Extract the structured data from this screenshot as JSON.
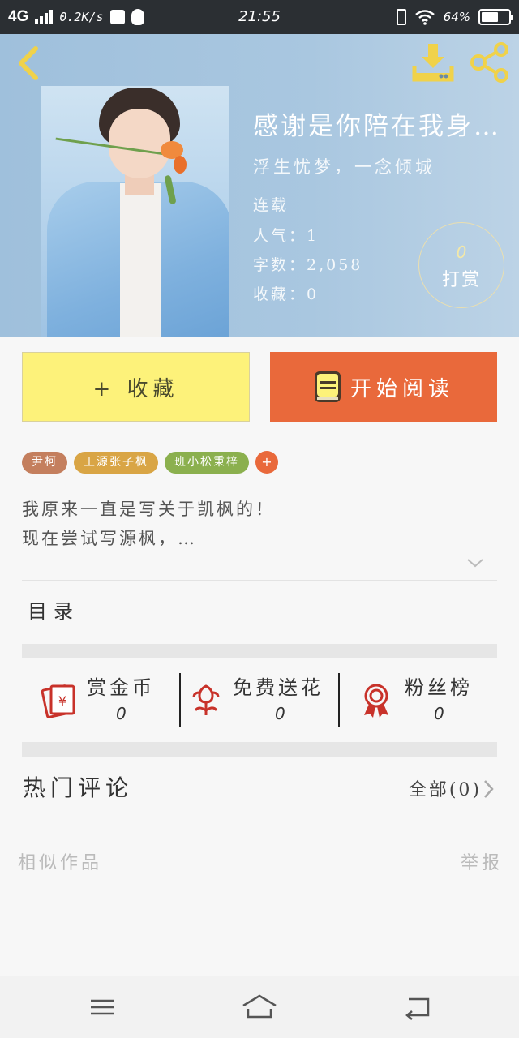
{
  "status_bar": {
    "network": "4G",
    "speed": "0.2K/s",
    "time": "21:55",
    "battery": "64%",
    "battery_level": 0.64
  },
  "header": {
    "icons": [
      "back-icon",
      "download-icon",
      "share-icon"
    ],
    "book": {
      "title": "感谢是你陪在我身…",
      "author_line": "浮生忧梦，一念倾城",
      "status": "连载",
      "popularity": "人气：1",
      "word_count": "字数：2,058",
      "favorites": "收藏：0"
    },
    "tip": {
      "count": "0",
      "label": "打赏"
    }
  },
  "actions": {
    "collect_label": "+ 收藏",
    "read_label": "开始阅读"
  },
  "tags": [
    {
      "label": "尹柯",
      "color": "#c47f5e"
    },
    {
      "label": "王源张子枫",
      "color": "#d9a545"
    },
    {
      "label": "班小松秉梓",
      "color": "#8bb04e"
    }
  ],
  "tag_add": "+",
  "intro": {
    "line1": "我原来一直是写关于凯枫的！",
    "line2": "现在尝试写源枫，…"
  },
  "toc_label": "目录",
  "stats": [
    {
      "label": "赏金币",
      "value": "0",
      "icon": "red-envelope-icon"
    },
    {
      "label": "免费送花",
      "value": "0",
      "icon": "flower-icon"
    },
    {
      "label": "粉丝榜",
      "value": "0",
      "icon": "medal-icon"
    }
  ],
  "comments": {
    "title": "热门评论",
    "all_link": "全部(0)"
  },
  "footer_links": {
    "similar": "相似作品",
    "report": "举报"
  },
  "nav": [
    "menu-icon",
    "home-icon",
    "return-icon"
  ],
  "colors": {
    "accent_orange": "#e9693b",
    "collect_yellow": "#fdf27a",
    "header_blue": "#a9c7e0",
    "icon_yellow": "#f0d24a",
    "stat_red": "#c8322a"
  }
}
